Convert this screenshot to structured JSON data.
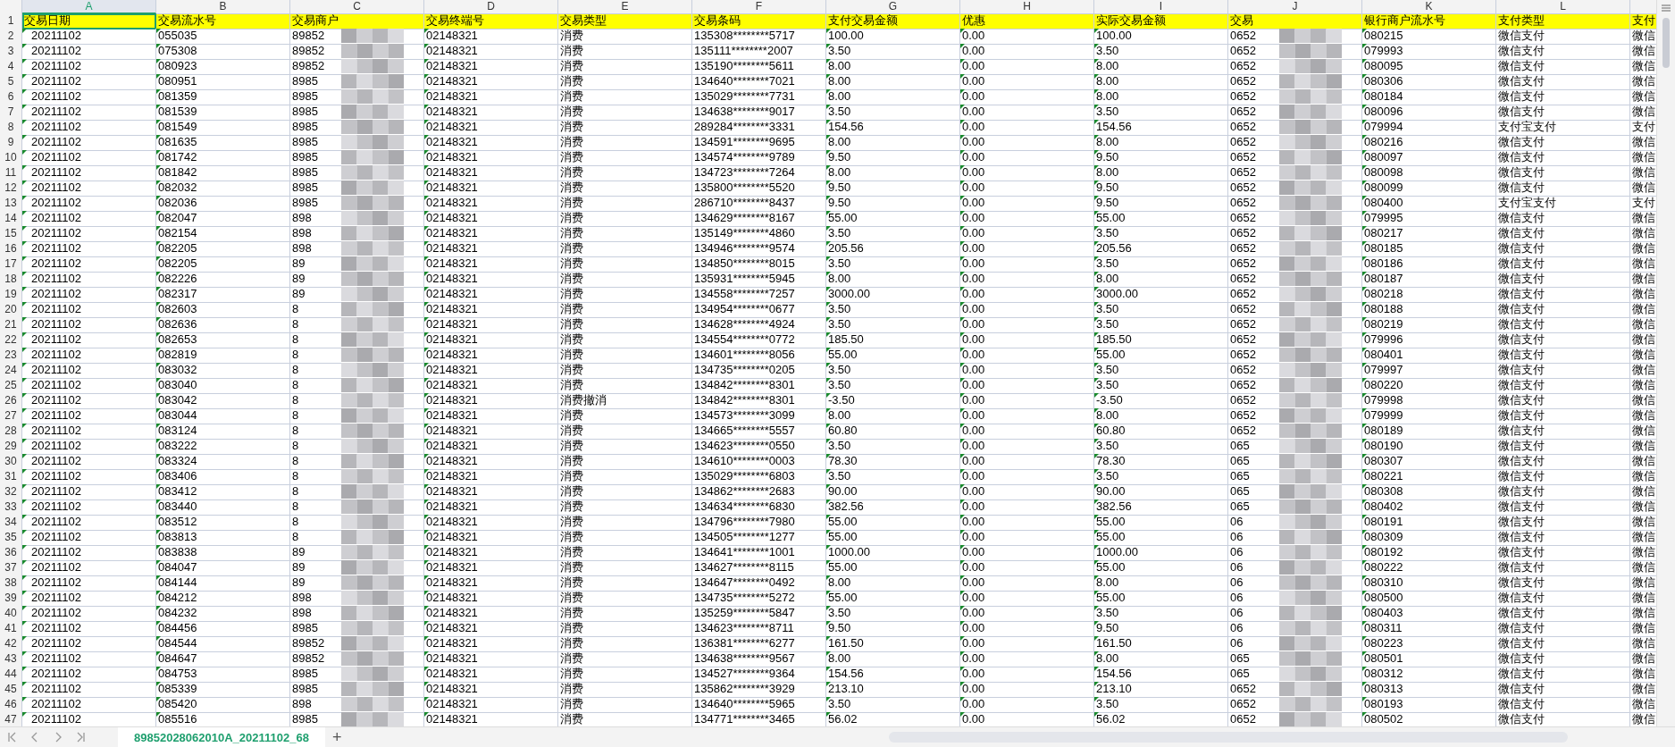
{
  "columns": [
    {
      "letter": "A",
      "header": "交易日期",
      "selected": true,
      "marker": true
    },
    {
      "letter": "B",
      "header": "交易流水号",
      "selected": false,
      "marker": true
    },
    {
      "letter": "C",
      "header": "交易商户",
      "selected": false,
      "marker": false,
      "redacted": true
    },
    {
      "letter": "D",
      "header": "交易终端号",
      "selected": false,
      "marker": true
    },
    {
      "letter": "E",
      "header": "交易类型",
      "selected": false,
      "marker": false
    },
    {
      "letter": "F",
      "header": "交易条码",
      "selected": false,
      "marker": false
    },
    {
      "letter": "G",
      "header": "支付交易金额",
      "selected": false,
      "marker": true
    },
    {
      "letter": "H",
      "header": "优惠",
      "selected": false,
      "marker": true
    },
    {
      "letter": "I",
      "header": "实际交易金额",
      "selected": false,
      "marker": true
    },
    {
      "letter": "J",
      "header": "交易",
      "selected": false,
      "marker": false,
      "redacted": true
    },
    {
      "letter": "K",
      "header": "银行商户流水号",
      "selected": false,
      "marker": true
    },
    {
      "letter": "L",
      "header": "支付类型",
      "selected": false,
      "marker": false
    },
    {
      "header": "支付",
      "selected": false,
      "marker": false
    }
  ],
  "header_row_number": "1",
  "rows": [
    {
      "number": "2",
      "cells": [
        "20211102",
        "055035",
        "89852",
        "02148321",
        "消费",
        "135308********5717",
        "100.00",
        "0.00",
        "100.00",
        "0652",
        "080215",
        "微信支付",
        "微信"
      ]
    },
    {
      "number": "3",
      "cells": [
        "20211102",
        "075308",
        "89852",
        "02148321",
        "消费",
        "135111********2007",
        "3.50",
        "0.00",
        "3.50",
        "0652",
        "079993",
        "微信支付",
        "微信"
      ]
    },
    {
      "number": "4",
      "cells": [
        "20211102",
        "080923",
        "89852",
        "02148321",
        "消费",
        "135190********5611",
        "8.00",
        "0.00",
        "8.00",
        "0652",
        "080095",
        "微信支付",
        "微信"
      ]
    },
    {
      "number": "5",
      "cells": [
        "20211102",
        "080951",
        "8985",
        "02148321",
        "消费",
        "134640********7021",
        "8.00",
        "0.00",
        "8.00",
        "0652",
        "080306",
        "微信支付",
        "微信"
      ]
    },
    {
      "number": "6",
      "cells": [
        "20211102",
        "081359",
        "8985",
        "02148321",
        "消费",
        "135029********7731",
        "8.00",
        "0.00",
        "8.00",
        "0652",
        "080184",
        "微信支付",
        "微信"
      ]
    },
    {
      "number": "7",
      "cells": [
        "20211102",
        "081539",
        "8985",
        "02148321",
        "消费",
        "134638********9017",
        "3.50",
        "0.00",
        "3.50",
        "0652",
        "080096",
        "微信支付",
        "微信"
      ]
    },
    {
      "number": "8",
      "cells": [
        "20211102",
        "081549",
        "8985",
        "02148321",
        "消费",
        "289284********3331",
        "154.56",
        "0.00",
        "154.56",
        "0652",
        "079994",
        "支付宝支付",
        "支付"
      ]
    },
    {
      "number": "9",
      "cells": [
        "20211102",
        "081635",
        "8985",
        "02148321",
        "消费",
        "134591********9695",
        "8.00",
        "0.00",
        "8.00",
        "0652",
        "080216",
        "微信支付",
        "微信"
      ]
    },
    {
      "number": "10",
      "cells": [
        "20211102",
        "081742",
        "8985",
        "02148321",
        "消费",
        "134574********9789",
        "9.50",
        "0.00",
        "9.50",
        "0652",
        "080097",
        "微信支付",
        "微信"
      ]
    },
    {
      "number": "11",
      "cells": [
        "20211102",
        "081842",
        "8985",
        "02148321",
        "消费",
        "134723********7264",
        "8.00",
        "0.00",
        "8.00",
        "0652",
        "080098",
        "微信支付",
        "微信"
      ]
    },
    {
      "number": "12",
      "cells": [
        "20211102",
        "082032",
        "8985",
        "02148321",
        "消费",
        "135800********5520",
        "9.50",
        "0.00",
        "9.50",
        "0652",
        "080099",
        "微信支付",
        "微信"
      ]
    },
    {
      "number": "13",
      "cells": [
        "20211102",
        "082036",
        "8985",
        "02148321",
        "消费",
        "286710********8437",
        "9.50",
        "0.00",
        "9.50",
        "0652",
        "080400",
        "支付宝支付",
        "支付"
      ]
    },
    {
      "number": "14",
      "cells": [
        "20211102",
        "082047",
        "898",
        "02148321",
        "消费",
        "134629********8167",
        "55.00",
        "0.00",
        "55.00",
        "0652",
        "079995",
        "微信支付",
        "微信"
      ]
    },
    {
      "number": "15",
      "cells": [
        "20211102",
        "082154",
        "898",
        "02148321",
        "消费",
        "135149********4860",
        "3.50",
        "0.00",
        "3.50",
        "0652",
        "080217",
        "微信支付",
        "微信"
      ]
    },
    {
      "number": "16",
      "cells": [
        "20211102",
        "082205",
        "898",
        "02148321",
        "消费",
        "134946********9574",
        "205.56",
        "0.00",
        "205.56",
        "0652",
        "080185",
        "微信支付",
        "微信"
      ]
    },
    {
      "number": "17",
      "cells": [
        "20211102",
        "082205",
        "89",
        "02148321",
        "消费",
        "134850********8015",
        "3.50",
        "0.00",
        "3.50",
        "0652",
        "080186",
        "微信支付",
        "微信"
      ]
    },
    {
      "number": "18",
      "cells": [
        "20211102",
        "082226",
        "89",
        "02148321",
        "消费",
        "135931********5945",
        "8.00",
        "0.00",
        "8.00",
        "0652",
        "080187",
        "微信支付",
        "微信"
      ]
    },
    {
      "number": "19",
      "cells": [
        "20211102",
        "082317",
        "89",
        "02148321",
        "消费",
        "134558********7257",
        "3000.00",
        "0.00",
        "3000.00",
        "0652",
        "080218",
        "微信支付",
        "微信"
      ]
    },
    {
      "number": "20",
      "cells": [
        "20211102",
        "082603",
        "8",
        "02148321",
        "消费",
        "134954********0677",
        "3.50",
        "0.00",
        "3.50",
        "0652",
        "080188",
        "微信支付",
        "微信"
      ]
    },
    {
      "number": "21",
      "cells": [
        "20211102",
        "082636",
        "8",
        "02148321",
        "消费",
        "134628********4924",
        "3.50",
        "0.00",
        "3.50",
        "0652",
        "080219",
        "微信支付",
        "微信"
      ]
    },
    {
      "number": "22",
      "cells": [
        "20211102",
        "082653",
        "8",
        "02148321",
        "消费",
        "134554********0772",
        "185.50",
        "0.00",
        "185.50",
        "0652",
        "079996",
        "微信支付",
        "微信"
      ]
    },
    {
      "number": "23",
      "cells": [
        "20211102",
        "082819",
        "8",
        "02148321",
        "消费",
        "134601********8056",
        "55.00",
        "0.00",
        "55.00",
        "0652",
        "080401",
        "微信支付",
        "微信"
      ]
    },
    {
      "number": "24",
      "cells": [
        "20211102",
        "083032",
        "8",
        "02148321",
        "消费",
        "134735********0205",
        "3.50",
        "0.00",
        "3.50",
        "0652",
        "079997",
        "微信支付",
        "微信"
      ]
    },
    {
      "number": "25",
      "cells": [
        "20211102",
        "083040",
        "8",
        "02148321",
        "消费",
        "134842********8301",
        "3.50",
        "0.00",
        "3.50",
        "0652",
        "080220",
        "微信支付",
        "微信"
      ]
    },
    {
      "number": "26",
      "cells": [
        "20211102",
        "083042",
        "8",
        "02148321",
        "消费撤消",
        "134842********8301",
        "-3.50",
        "0.00",
        "-3.50",
        "0652",
        "079998",
        "微信支付",
        "微信"
      ]
    },
    {
      "number": "27",
      "cells": [
        "20211102",
        "083044",
        "8",
        "02148321",
        "消费",
        "134573********3099",
        "8.00",
        "0.00",
        "8.00",
        "0652",
        "079999",
        "微信支付",
        "微信"
      ]
    },
    {
      "number": "28",
      "cells": [
        "20211102",
        "083124",
        "8",
        "02148321",
        "消费",
        "134665********5557",
        "60.80",
        "0.00",
        "60.80",
        "0652",
        "080189",
        "微信支付",
        "微信"
      ]
    },
    {
      "number": "29",
      "cells": [
        "20211102",
        "083222",
        "8",
        "02148321",
        "消费",
        "134623********0550",
        "3.50",
        "0.00",
        "3.50",
        "065",
        "080190",
        "微信支付",
        "微信"
      ]
    },
    {
      "number": "30",
      "cells": [
        "20211102",
        "083324",
        "8",
        "02148321",
        "消费",
        "134610********0003",
        "78.30",
        "0.00",
        "78.30",
        "065",
        "080307",
        "微信支付",
        "微信"
      ]
    },
    {
      "number": "31",
      "cells": [
        "20211102",
        "083406",
        "8",
        "02148321",
        "消费",
        "135029********6803",
        "3.50",
        "0.00",
        "3.50",
        "065",
        "080221",
        "微信支付",
        "微信"
      ]
    },
    {
      "number": "32",
      "cells": [
        "20211102",
        "083412",
        "8",
        "02148321",
        "消费",
        "134862********2683",
        "90.00",
        "0.00",
        "90.00",
        "065",
        "080308",
        "微信支付",
        "微信"
      ]
    },
    {
      "number": "33",
      "cells": [
        "20211102",
        "083440",
        "8",
        "02148321",
        "消费",
        "134634********6830",
        "382.56",
        "0.00",
        "382.56",
        "065",
        "080402",
        "微信支付",
        "微信"
      ]
    },
    {
      "number": "34",
      "cells": [
        "20211102",
        "083512",
        "8",
        "02148321",
        "消费",
        "134796********7980",
        "55.00",
        "0.00",
        "55.00",
        "06",
        "080191",
        "微信支付",
        "微信"
      ]
    },
    {
      "number": "35",
      "cells": [
        "20211102",
        "083813",
        "8",
        "02148321",
        "消费",
        "134505********1277",
        "55.00",
        "0.00",
        "55.00",
        "06",
        "080309",
        "微信支付",
        "微信"
      ]
    },
    {
      "number": "36",
      "cells": [
        "20211102",
        "083838",
        "89",
        "02148321",
        "消费",
        "134641********1001",
        "1000.00",
        "0.00",
        "1000.00",
        "06",
        "080192",
        "微信支付",
        "微信"
      ]
    },
    {
      "number": "37",
      "cells": [
        "20211102",
        "084047",
        "89",
        "02148321",
        "消费",
        "134627********8115",
        "55.00",
        "0.00",
        "55.00",
        "06",
        "080222",
        "微信支付",
        "微信"
      ]
    },
    {
      "number": "38",
      "cells": [
        "20211102",
        "084144",
        "89",
        "02148321",
        "消费",
        "134647********0492",
        "8.00",
        "0.00",
        "8.00",
        "06",
        "080310",
        "微信支付",
        "微信"
      ]
    },
    {
      "number": "39",
      "cells": [
        "20211102",
        "084212",
        "898",
        "02148321",
        "消费",
        "134735********5272",
        "55.00",
        "0.00",
        "55.00",
        "06",
        "080500",
        "微信支付",
        "微信"
      ]
    },
    {
      "number": "40",
      "cells": [
        "20211102",
        "084232",
        "898",
        "02148321",
        "消费",
        "135259********5847",
        "3.50",
        "0.00",
        "3.50",
        "06",
        "080403",
        "微信支付",
        "微信"
      ]
    },
    {
      "number": "41",
      "cells": [
        "20211102",
        "084456",
        "8985",
        "02148321",
        "消费",
        "134623********8711",
        "9.50",
        "0.00",
        "9.50",
        "06",
        "080311",
        "微信支付",
        "微信"
      ]
    },
    {
      "number": "42",
      "cells": [
        "20211102",
        "084544",
        "89852",
        "02148321",
        "消费",
        "136381********6277",
        "161.50",
        "0.00",
        "161.50",
        "06",
        "080223",
        "微信支付",
        "微信"
      ]
    },
    {
      "number": "43",
      "cells": [
        "20211102",
        "084647",
        "89852",
        "02148321",
        "消费",
        "134638********9567",
        "8.00",
        "0.00",
        "8.00",
        "065",
        "080501",
        "微信支付",
        "微信"
      ]
    },
    {
      "number": "44",
      "cells": [
        "20211102",
        "084753",
        "8985",
        "02148321",
        "消费",
        "134527********9364",
        "154.56",
        "0.00",
        "154.56",
        "065",
        "080312",
        "微信支付",
        "微信"
      ]
    },
    {
      "number": "45",
      "cells": [
        "20211102",
        "085339",
        "8985",
        "02148321",
        "消费",
        "135862********3929",
        "213.10",
        "0.00",
        "213.10",
        "0652",
        "080313",
        "微信支付",
        "微信"
      ]
    },
    {
      "number": "46",
      "cells": [
        "20211102",
        "085420",
        "898",
        "02148321",
        "消费",
        "134640********5965",
        "3.50",
        "0.00",
        "3.50",
        "0652",
        "080193",
        "微信支付",
        "微信"
      ]
    },
    {
      "number": "47",
      "cells": [
        "20211102",
        "085516",
        "8985",
        "02148321",
        "消费",
        "134771********3465",
        "56.02",
        "0.00",
        "56.02",
        "0652",
        "080502",
        "微信支付",
        "微信"
      ]
    }
  ],
  "sheet_tabs": [
    {
      "label": "89852028062010A_20211102_68",
      "selected": true
    }
  ],
  "add_sheet": "+"
}
